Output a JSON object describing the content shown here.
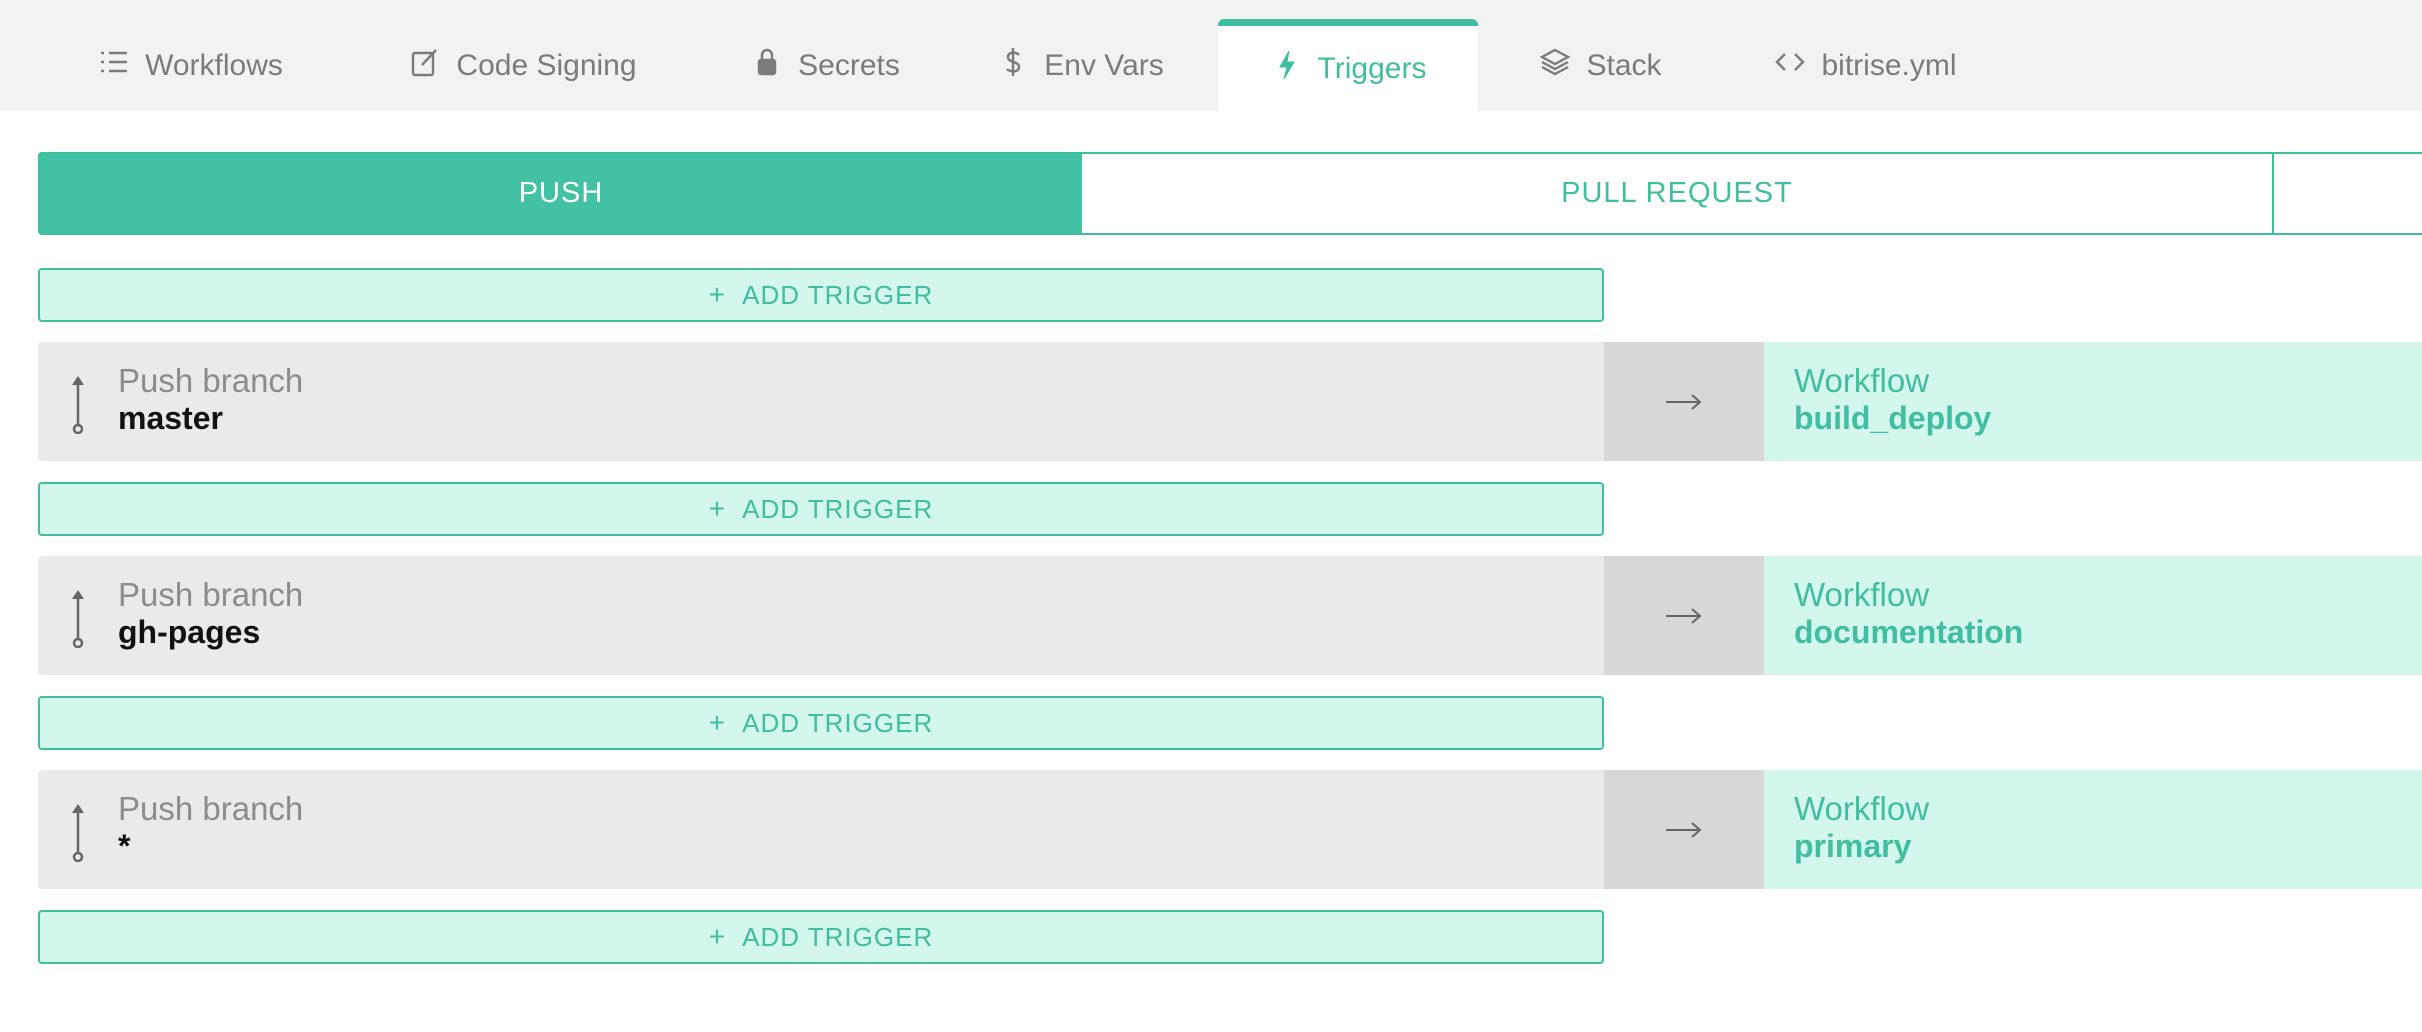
{
  "tabs": [
    {
      "label": "Workflows",
      "icon": "list-icon"
    },
    {
      "label": "Code Signing",
      "icon": "edit-icon"
    },
    {
      "label": "Secrets",
      "icon": "lock-icon"
    },
    {
      "label": "Env Vars",
      "icon": "dollar-icon"
    },
    {
      "label": "Triggers",
      "icon": "lightning-icon",
      "active": true
    },
    {
      "label": "Stack",
      "icon": "layers-icon"
    },
    {
      "label": "bitrise.yml",
      "icon": "code-icon"
    }
  ],
  "segments": {
    "push": "PUSH",
    "pull_request": "PULL REQUEST",
    "selected": "PUSH"
  },
  "add_trigger_label": "ADD TRIGGER",
  "add_trigger_plus": "+",
  "arrow": "→",
  "triggers": [
    {
      "type_label": "Push branch",
      "branch": "master",
      "workflow_label": "Workflow",
      "workflow": "build_deploy"
    },
    {
      "type_label": "Push branch",
      "branch": "gh-pages",
      "workflow_label": "Workflow",
      "workflow": "documentation"
    },
    {
      "type_label": "Push branch",
      "branch": "*",
      "workflow_label": "Workflow",
      "workflow": "primary"
    }
  ],
  "colors": {
    "accent": "#3fbf9f",
    "accent_fill": "#42c2a3",
    "accent_light": "#d3f6ed",
    "row_bg": "#eaeaea",
    "arrow_bg": "#d7d7d7",
    "tabbar_bg": "#f2f2f2"
  }
}
